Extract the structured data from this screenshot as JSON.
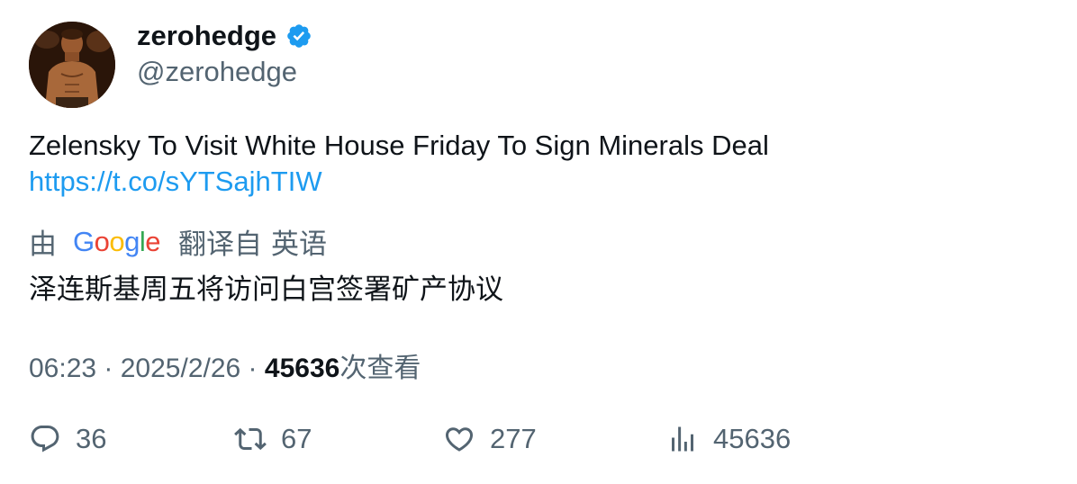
{
  "author": {
    "display_name": "zerohedge",
    "handle": "@zerohedge",
    "verified_icon": "verified-badge-icon",
    "avatar_icon": "avatar"
  },
  "tweet": {
    "text": "Zelensky To Visit White House Friday To Sign Minerals Deal",
    "link": "https://t.co/sYTSajhTIW"
  },
  "translation": {
    "by": "由",
    "provider_letters": [
      "G",
      "o",
      "o",
      "g",
      "l",
      "e"
    ],
    "translated_from": "翻译自",
    "language": "英语",
    "text": "泽连斯基周五将访问白宫签署矿产协议"
  },
  "meta": {
    "time": "06:23",
    "separator": " · ",
    "date": "2025/2/26",
    "views_count": "45636",
    "views_label": "次查看"
  },
  "actions": {
    "replies": "36",
    "retweets": "67",
    "likes": "277",
    "views": "45636"
  },
  "colors": {
    "link": "#1d9bf0",
    "secondary_text": "#536471",
    "primary_text": "#0f1419",
    "verified": "#1d9bf0"
  }
}
